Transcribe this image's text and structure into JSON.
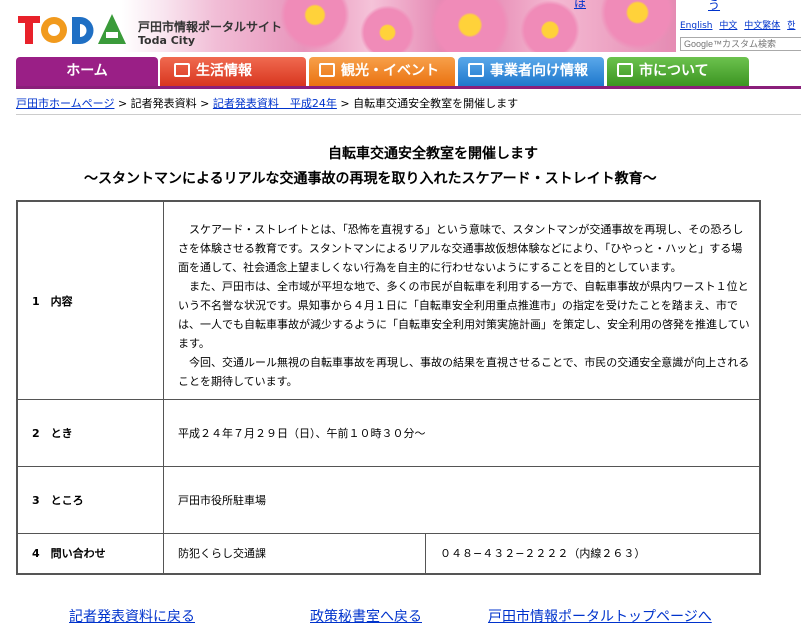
{
  "header": {
    "site_name_ja": "戸田市情報ポータルサイト",
    "site_name_en": "Toda City",
    "logo_text": "TODA",
    "top_link": "ほ",
    "top_link2": "う",
    "languages": [
      "English",
      "中文",
      "中文繁体",
      "한"
    ],
    "search_placeholder": "Google™カスタム検索"
  },
  "nav": {
    "tabs": [
      {
        "label": "ホーム",
        "color": "#9a1f86"
      },
      {
        "label": "生活情報",
        "color": "#e8452d"
      },
      {
        "label": "観光・イベント",
        "color": "#f07d1f"
      },
      {
        "label": "事業者向け情報",
        "color": "#2e8ad8"
      },
      {
        "label": "市について",
        "color": "#4aa52d"
      }
    ]
  },
  "breadcrumb": {
    "home": "戸田市ホームページ",
    "sep": ">",
    "level2": "記者発表資料",
    "level3": "記者発表資料　平成24年",
    "current": "自転車交通安全教室を開催します"
  },
  "article": {
    "title": "自転車交通安全教室を開催します",
    "subtitle": "〜スタントマンによるリアルな交通事故の再現を取り入れたスケアード・ストレイト教育〜",
    "rows": [
      {
        "label": "1　内容",
        "paragraphs": [
          "スケアード・ストレイトとは、「恐怖を直視する」という意味で、スタントマンが交通事故を再現し、その恐ろしさを体験させる教育です。スタントマンによるリアルな交通事故仮想体験などにより、「ひやっと・ハッと」する場面を通して、社会通念上望ましくない行為を自主的に行わせないようにすることを目的としています。",
          "また、戸田市は、全市域が平坦な地で、多くの市民が自転車を利用する一方で、自転車事故が県内ワースト１位という不名誉な状況です。県知事から４月１日に「自転車安全利用重点推進市」の指定を受けたことを踏まえ、市では、一人でも自転車事故が減少するように「自転車安全利用対策実施計画」を策定し、安全利用の啓発を推進しています。",
          "今回、交通ルール無視の自転車事故を再現し、事故の結果を直視させることで、市民の交通安全意識が向上されることを期待しています。"
        ]
      },
      {
        "label": "2　とき",
        "value": "平成２４年７月２９日（日）、午前１０時３０分〜"
      },
      {
        "label": "3　ところ",
        "value": "戸田市役所駐車場"
      },
      {
        "label": "4　問い合わせ",
        "value": "防犯くらし交通課",
        "phone": "０４８−４３２−２２２２（内線２６３）"
      }
    ]
  },
  "footer": {
    "links": [
      "記者発表資料に戻る",
      "政策秘書室へ戻る",
      "戸田市情報ポータルトップページへ"
    ]
  }
}
